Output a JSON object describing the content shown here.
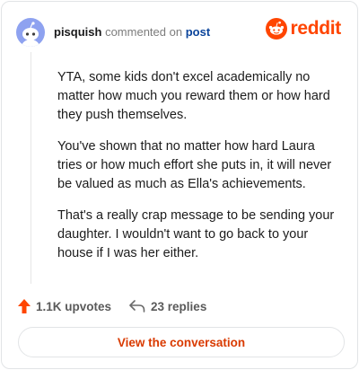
{
  "comment": {
    "username": "pisquish",
    "action_text": "commented on",
    "post_link_text": "post",
    "brand_name": "reddit",
    "paragraphs": [
      "YTA, some kids don't excel academically no matter how much you reward them or how hard they push themselves.",
      "You've shown that no matter how hard Laura tries or how much effort she puts in, it will never be valued as much as Ella's achievements.",
      "That's a really crap message to be sending your daughter. I wouldn't want to go back to your house if I was her either."
    ],
    "upvotes_text": "1.1K upvotes",
    "replies_text": "23 replies",
    "cta_label": "View the conversation"
  },
  "icons": {
    "avatar": "snoo-avatar-icon",
    "brand": "reddit-logo-icon",
    "upvote": "upvote-arrow-icon",
    "reply": "reply-arrow-icon"
  },
  "colors": {
    "brand": "#ff4500",
    "upvote": "#ff4500",
    "link": "#0a449b",
    "cta_text": "#d93a00",
    "avatar_bg": "#8ea2f0"
  }
}
